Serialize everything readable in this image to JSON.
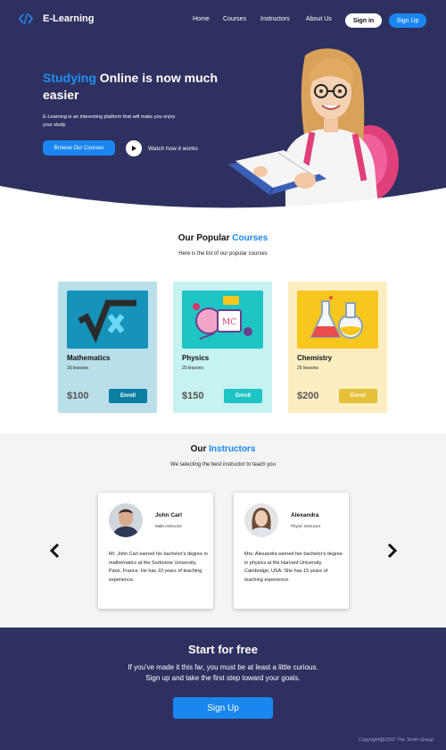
{
  "brand": {
    "name": "E-Learning",
    "icon": "code-icon"
  },
  "nav": {
    "links": [
      "Home",
      "Courses",
      "Instructors",
      "About Us"
    ],
    "signin": "Sign in",
    "signup": "Sign Up"
  },
  "hero": {
    "title_highlight": "Studying",
    "title_rest": " Online is now much easier",
    "description": "E-Learning is an interesting platform that will make you enjoy your study",
    "browse_button": "Browse Our Courses",
    "watch_label": "Watch how it works"
  },
  "courses": {
    "title_prefix": "Our Popular ",
    "title_highlight": "Courses",
    "subtitle": "Here is the list of our popular courses",
    "items": [
      {
        "name": "Mathematics",
        "lessons": "16 lessons",
        "price": "$100",
        "enroll": "Enroll",
        "card_color": "#b9dfeb",
        "image_color": "#1792b8",
        "button_color": "#0e7ea3",
        "icon": "math-sqrt-icon"
      },
      {
        "name": "Physics",
        "lessons": "20 lessons",
        "price": "$150",
        "enroll": "Enroll",
        "card_color": "#c6f2ef",
        "image_color": "#1fc4c4",
        "button_color": "#1fc4c4",
        "icon": "physics-emc2-icon"
      },
      {
        "name": "Chemistry",
        "lessons": "25 lessons",
        "price": "$200",
        "enroll": "Enroll",
        "card_color": "#fdeec2",
        "image_color": "#f9c61e",
        "button_color": "#e6c035",
        "icon": "chemistry-flask-icon"
      }
    ]
  },
  "instructors": {
    "title_prefix": "Our ",
    "title_highlight": "Instructors",
    "subtitle": "We selecting the best instructor to teach you",
    "items": [
      {
        "name": "John Carl",
        "role": "Math Instructor",
        "bio": "Mr. John Carl earned his bachelor's degree in mathematics at the Sorbonne University, Paris, France. He has 10 years of teaching experience."
      },
      {
        "name": "Alexandra",
        "role": "Physic Instructor",
        "bio": "Mrs. Alexandra earned her bachelor's degree in physics at the Harvard University, Cambridge, USA. She has 15 years of teaching experience."
      }
    ]
  },
  "footer": {
    "title": "Start for free",
    "line1": "If you've made it this far, you must be at least a little curious.",
    "line2": "Sign up and take the first step toward your goals.",
    "signup": "Sign Up",
    "copyright": "Copyright@2022 The Tenth Group"
  },
  "colors": {
    "navy": "#2e3160",
    "accent": "#1a87f0"
  }
}
